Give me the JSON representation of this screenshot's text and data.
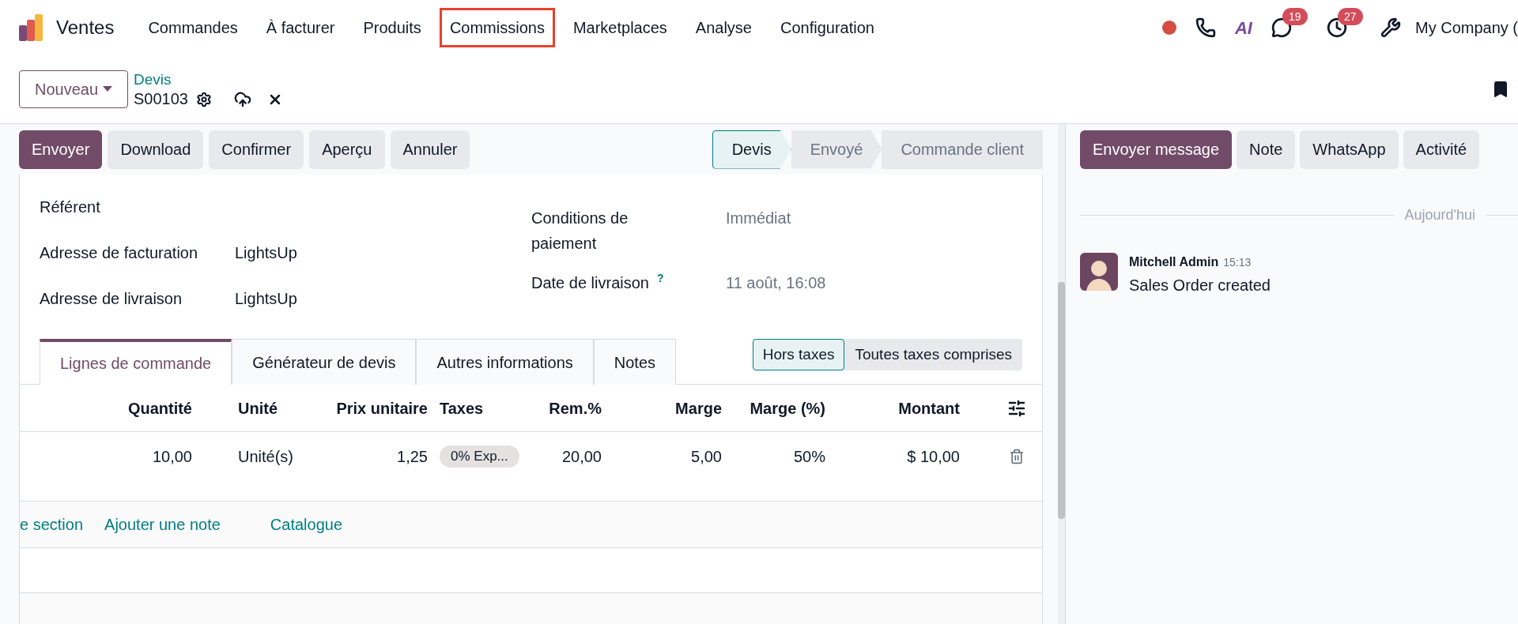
{
  "navbar": {
    "app_name": "Ventes",
    "menu": [
      {
        "label": "Commandes",
        "highlighted": false
      },
      {
        "label": "À facturer",
        "highlighted": false
      },
      {
        "label": "Produits",
        "highlighted": false
      },
      {
        "label": "Commissions",
        "highlighted": true
      },
      {
        "label": "Marketplaces",
        "highlighted": false
      },
      {
        "label": "Analyse",
        "highlighted": false
      },
      {
        "label": "Configuration",
        "highlighted": false
      }
    ],
    "systray": {
      "ai_label": "AI",
      "chat_badge": "19",
      "activity_badge": "27",
      "company": "My Company ("
    }
  },
  "control_panel": {
    "new_button": "Nouveau",
    "breadcrumb": "Devis",
    "record": "S00103"
  },
  "actions": [
    {
      "label": "Envoyer",
      "kind": "primary"
    },
    {
      "label": "Download",
      "kind": "secondary"
    },
    {
      "label": "Confirmer",
      "kind": "secondary"
    },
    {
      "label": "Aperçu",
      "kind": "secondary"
    },
    {
      "label": "Annuler",
      "kind": "secondary"
    }
  ],
  "status_steps": [
    {
      "label": "Devis",
      "selected": true
    },
    {
      "label": "Envoyé",
      "selected": false
    },
    {
      "label": "Commande client",
      "selected": false
    }
  ],
  "form": {
    "left": [
      {
        "label": "Référent"
      },
      {
        "label": "Adresse de facturation",
        "value": "LightsUp",
        "readonly": false
      },
      {
        "label": "Adresse de livraison",
        "value": "LightsUp",
        "readonly": false
      }
    ],
    "right": [
      {
        "label": "Conditions de paiement",
        "value": "Immédiat",
        "readonly": true
      },
      {
        "label": "Date de livraison",
        "help": "?",
        "value": "11 août, 16:08",
        "readonly": true
      }
    ]
  },
  "tabs": [
    {
      "label": "Lignes de commande",
      "selected": true
    },
    {
      "label": "Générateur de devis",
      "selected": false
    },
    {
      "label": "Autres informations",
      "selected": false
    },
    {
      "label": "Notes",
      "selected": false
    }
  ],
  "tax_toggle": [
    {
      "label": "Hors taxes",
      "selected": true
    },
    {
      "label": "Toutes taxes comprises",
      "selected": false
    }
  ],
  "table": {
    "columns": [
      "Quantité",
      "Unité",
      "Prix unitaire",
      "Taxes",
      "Rem.%",
      "Marge",
      "Marge (%)",
      "Montant"
    ],
    "rows": [
      {
        "cells": [
          "10,00",
          "Unité(s)",
          "1,25",
          "0% Exp...",
          "20,00",
          "5,00",
          "50%",
          "$ 10,00"
        ]
      }
    ],
    "add_links": [
      "e section",
      "Ajouter une note",
      "Catalogue"
    ]
  },
  "chatter": {
    "buttons": [
      {
        "label": "Envoyer message",
        "kind": "primary"
      },
      {
        "label": "Note",
        "kind": "secondary"
      },
      {
        "label": "WhatsApp",
        "kind": "secondary"
      },
      {
        "label": "Activité",
        "kind": "secondary"
      }
    ],
    "separator": "Aujourd'hui",
    "messages": [
      {
        "author": "Mitchell Admin",
        "time": "15:13",
        "body": "Sales Order created"
      }
    ]
  }
}
